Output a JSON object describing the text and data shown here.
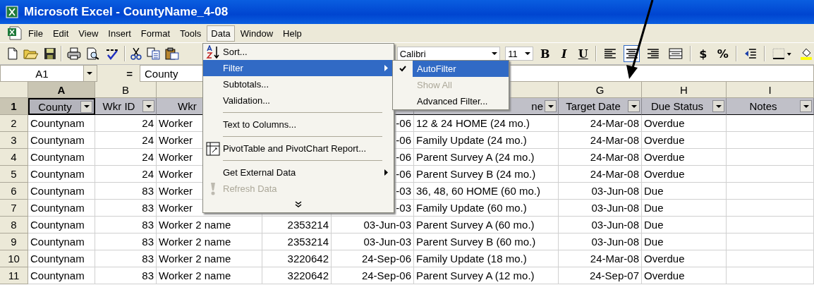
{
  "window": {
    "title": "Microsoft Excel - CountyName_4-08"
  },
  "menu_bar": [
    {
      "label": "File",
      "selected": false
    },
    {
      "label": "Edit",
      "selected": false
    },
    {
      "label": "View",
      "selected": false
    },
    {
      "label": "Insert",
      "selected": false
    },
    {
      "label": "Format",
      "selected": false
    },
    {
      "label": "Tools",
      "selected": false
    },
    {
      "label": "Data",
      "selected": true
    },
    {
      "label": "Window",
      "selected": false
    },
    {
      "label": "Help",
      "selected": false
    }
  ],
  "standard_toolbar": [
    {
      "kind": "new"
    },
    {
      "kind": "open"
    },
    {
      "kind": "save"
    },
    {
      "kind": "separator"
    },
    {
      "kind": "print"
    },
    {
      "kind": "preview"
    },
    {
      "kind": "spelling"
    },
    {
      "kind": "separator"
    },
    {
      "kind": "cut"
    },
    {
      "kind": "copy"
    },
    {
      "kind": "paste"
    }
  ],
  "formatting_toolbar": {
    "font": "Calibri",
    "size": "11",
    "buttons": [
      {
        "kind": "bold",
        "label": "B",
        "pressed": false
      },
      {
        "kind": "italic",
        "label": "I",
        "pressed": false
      },
      {
        "kind": "underline",
        "label": "U",
        "pressed": false
      },
      {
        "kind": "separator"
      },
      {
        "kind": "align-left",
        "pressed": false
      },
      {
        "kind": "align-center",
        "pressed": true
      },
      {
        "kind": "align-right",
        "pressed": false
      },
      {
        "kind": "merge",
        "pressed": false
      },
      {
        "kind": "separator"
      },
      {
        "kind": "currency",
        "label": "$",
        "pressed": false
      },
      {
        "kind": "percent",
        "label": "%",
        "pressed": false
      },
      {
        "kind": "separator"
      },
      {
        "kind": "indent",
        "pressed": false
      },
      {
        "kind": "separator"
      },
      {
        "kind": "borders",
        "pressed": false
      },
      {
        "kind": "fill",
        "pressed": false
      }
    ]
  },
  "formula_bar": {
    "name_box": "A1",
    "equals": "=",
    "formula": "County"
  },
  "columns": [
    {
      "letter": "A",
      "selected": true
    },
    {
      "letter": "B",
      "selected": false
    },
    null,
    null,
    null,
    null,
    {
      "letter": "G",
      "selected": false
    },
    {
      "letter": "H",
      "selected": false
    },
    {
      "letter": "I",
      "selected": false
    }
  ],
  "filter_row": {
    "number": "1",
    "selected": true,
    "cells": [
      {
        "text": "County",
        "filter": true,
        "selected": true
      },
      {
        "text": "Wkr ID",
        "filter": true,
        "selected": false
      },
      {
        "text": "Wkr",
        "selected": false
      },
      null,
      null,
      {
        "text": "ne",
        "filter": true,
        "selected": false
      },
      {
        "text": "Target Date",
        "filter": true,
        "selected": false
      },
      {
        "text": "Due Status",
        "filter": true,
        "selected": false
      },
      {
        "text": "Notes",
        "filter": true,
        "selected": false
      }
    ]
  },
  "rows": [
    {
      "number": "2",
      "cells": [
        "Countynam",
        "24",
        "Worker",
        null,
        "-06",
        "12 & 24 HOME (24 mo.)",
        "24-Mar-08",
        "Overdue",
        null
      ]
    },
    {
      "number": "3",
      "cells": [
        "Countynam",
        "24",
        "Worker",
        null,
        "-06",
        "Family Update (24 mo.)",
        "24-Mar-08",
        "Overdue",
        null
      ]
    },
    {
      "number": "4",
      "cells": [
        "Countynam",
        "24",
        "Worker",
        null,
        "-06",
        "Parent Survey A (24 mo.)",
        "24-Mar-08",
        "Overdue",
        null
      ]
    },
    {
      "number": "5",
      "cells": [
        "Countynam",
        "24",
        "Worker",
        null,
        "-06",
        "Parent Survey B (24 mo.)",
        "24-Mar-08",
        "Overdue",
        null
      ]
    },
    {
      "number": "6",
      "cells": [
        "Countynam",
        "83",
        "Worker",
        null,
        "-03",
        "36, 48, 60 HOME (60 mo.)",
        "03-Jun-08",
        "Due",
        null
      ]
    },
    {
      "number": "7",
      "cells": [
        "Countynam",
        "83",
        "Worker",
        null,
        "-03",
        "Family Update (60 mo.)",
        "03-Jun-08",
        "Due",
        null
      ]
    },
    {
      "number": "8",
      "cells": [
        "Countynam",
        "83",
        "Worker 2 name",
        "2353214",
        "03-Jun-03",
        "Parent Survey A (60 mo.)",
        "03-Jun-08",
        "Due",
        null
      ]
    },
    {
      "number": "9",
      "cells": [
        "Countynam",
        "83",
        "Worker 2 name",
        "2353214",
        "03-Jun-03",
        "Parent Survey B (60 mo.)",
        "03-Jun-08",
        "Due",
        null
      ]
    },
    {
      "number": "10",
      "cells": [
        "Countynam",
        "83",
        "Worker 2 name",
        "3220642",
        "24-Sep-06",
        "Family Update (18 mo.)",
        "24-Mar-08",
        "Overdue",
        null
      ]
    },
    {
      "number": "11",
      "cells": [
        "Countynam",
        "83",
        "Worker 2 name",
        "3220642",
        "24-Sep-06",
        "Parent Survey A (12 mo.)",
        "24-Sep-07",
        "Overdue",
        null
      ]
    }
  ],
  "data_menu": {
    "items": [
      {
        "kind": "sort",
        "label": "Sort...",
        "selected": false,
        "disabled": false,
        "submenu": false
      },
      {
        "kind": "item",
        "label": "Filter",
        "selected": true,
        "disabled": false,
        "submenu": true
      },
      {
        "kind": "item",
        "label": "Subtotals...",
        "selected": false,
        "disabled": false,
        "submenu": false
      },
      {
        "kind": "item",
        "label": "Validation...",
        "selected": false,
        "disabled": false,
        "submenu": false
      },
      {
        "kind": "separator"
      },
      {
        "kind": "item",
        "label": "Text to Columns...",
        "selected": false,
        "disabled": false,
        "submenu": false
      },
      {
        "kind": "separator"
      },
      {
        "kind": "pivot",
        "label": "PivotTable and PivotChart Report...",
        "selected": false,
        "disabled": false,
        "submenu": false
      },
      {
        "kind": "separator"
      },
      {
        "kind": "item",
        "label": "Get External Data",
        "selected": false,
        "disabled": false,
        "submenu": true
      },
      {
        "kind": "refresh",
        "label": "Refresh Data",
        "selected": false,
        "disabled": true,
        "submenu": false
      },
      {
        "kind": "expand"
      }
    ]
  },
  "filter_submenu": {
    "items": [
      {
        "label": "AutoFilter",
        "checked": true,
        "selected": true,
        "disabled": false
      },
      {
        "label": "Show All",
        "checked": false,
        "selected": false,
        "disabled": true
      },
      {
        "label": "Advanced Filter...",
        "checked": false,
        "selected": false,
        "disabled": false
      }
    ]
  }
}
